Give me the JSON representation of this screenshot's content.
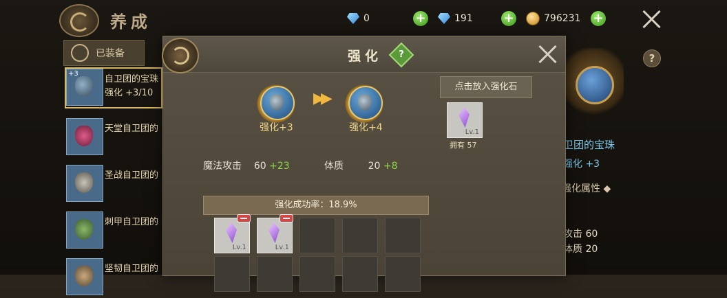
{
  "header": {
    "title": "养成",
    "diamonds": "0",
    "bound_diamonds": "191",
    "gold": "796231"
  },
  "left": {
    "equipped_tab": "已装备",
    "items": [
      {
        "name": "自卫团的宝珠",
        "level": "强化 +3/10",
        "badge": "+3"
      },
      {
        "name": "天堂自卫团的",
        "level": ""
      },
      {
        "name": "圣战自卫团的",
        "level": ""
      },
      {
        "name": "刺甲自卫团的",
        "level": ""
      },
      {
        "name": "坚韧自卫团的",
        "level": ""
      }
    ]
  },
  "right": {
    "name": "卫团的宝珠",
    "level": "强化 +3",
    "section": "强化属性",
    "stats": [
      {
        "label": "法攻击",
        "value": "60"
      },
      {
        "label": "体质",
        "value": "20"
      }
    ]
  },
  "modal": {
    "title": "强化",
    "help": "?",
    "from_level": "强化+3",
    "to_level": "强化+4",
    "stats": [
      {
        "label": "魔法攻击",
        "value": "60",
        "bonus": "+23"
      },
      {
        "label": "体质",
        "value": "20",
        "bonus": "+8"
      }
    ],
    "stone_header": "点击放入强化石",
    "stone_level": "Lv.1",
    "stone_owned": "拥有 57",
    "success_rate": "强化成功率：18.9%",
    "slots": [
      {
        "filled": true,
        "level": "Lv.1"
      },
      {
        "filled": true,
        "level": "Lv.1"
      }
    ]
  }
}
